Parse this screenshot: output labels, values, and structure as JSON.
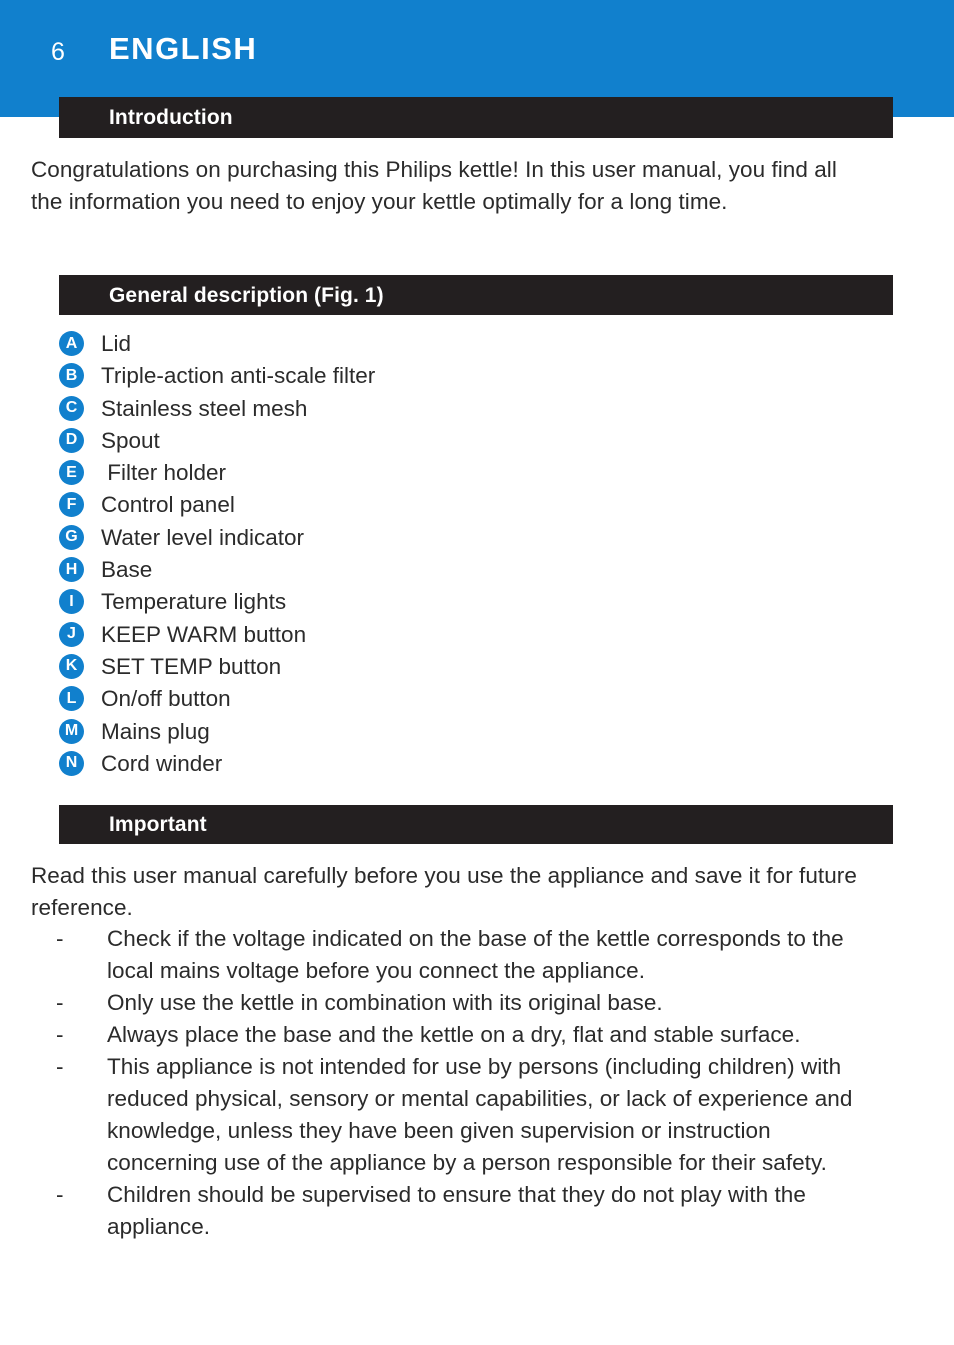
{
  "header": {
    "page_number": "6",
    "language": "ENGLISH",
    "background_color": "#1180cd"
  },
  "sections": {
    "introduction": {
      "bar_title": "Introduction",
      "paragraph": "Congratulations on purchasing this Philips kettle! In this user manual, you find all the information you need to enjoy your kettle optimally for a long time."
    },
    "general_description": {
      "bar_title": "General description (Fig. 1)",
      "items": [
        {
          "letter": "A",
          "label": "Lid"
        },
        {
          "letter": "B",
          "label": "Triple-action anti-scale filter"
        },
        {
          "letter": "C",
          "label": "Stainless steel mesh"
        },
        {
          "letter": "D",
          "label": "Spout"
        },
        {
          "letter": "E",
          "label": " Filter holder"
        },
        {
          "letter": "F",
          "label": "Control panel"
        },
        {
          "letter": "G",
          "label": "Water level indicator"
        },
        {
          "letter": "H",
          "label": "Base"
        },
        {
          "letter": "I",
          "label": "Temperature lights"
        },
        {
          "letter": "J",
          "label": "KEEP WARM button"
        },
        {
          "letter": "K",
          "label": "SET TEMP button"
        },
        {
          "letter": "L",
          "label": "On/off button"
        },
        {
          "letter": "M",
          "label": "Mains plug"
        },
        {
          "letter": "N",
          "label": "Cord winder"
        }
      ]
    },
    "important": {
      "bar_title": "Important",
      "paragraph": "Read this user manual carefully before you use the appliance and save it for future reference.",
      "bullet_mark": "-",
      "bullets": [
        "Check if the voltage indicated on the base of the kettle corresponds to the local mains voltage before you connect the appliance.",
        "Only use the kettle in combination with its original base.",
        "Always place the base and the kettle on a dry, flat and stable surface.",
        "This appliance is not intended for use by persons (including children) with reduced physical, sensory or mental capabilities, or lack of experience and knowledge, unless they have been given supervision or instruction concerning use of the appliance by a person responsible for their safety.",
        "Children should be supervised to ensure that they do not play with the appliance."
      ]
    }
  },
  "colors": {
    "accent_blue": "#1180cd",
    "bar_black": "#231f20",
    "body_text": "#2b2b2b"
  }
}
